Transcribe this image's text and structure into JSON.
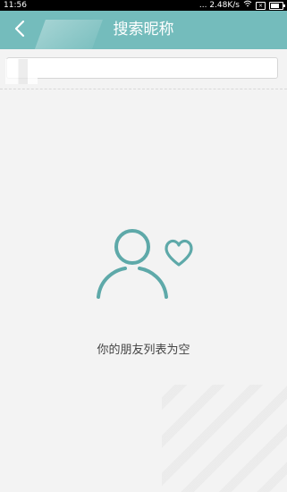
{
  "status_bar": {
    "time": "11:56",
    "net_speed": "... 2.48K/s",
    "icons": [
      "wifi-icon",
      "sim-x-icon",
      "battery-icon"
    ]
  },
  "header": {
    "title": "搜索昵称",
    "back_icon": "back-arrow-icon"
  },
  "search": {
    "value": "",
    "placeholder": ""
  },
  "empty_state": {
    "icon": "friend-empty-icon",
    "message": "你的朋友列表为空"
  },
  "colors": {
    "header_bg": "#74bcbc",
    "icon_teal": "#5ea9a9",
    "page_bg": "#f3f3f3"
  }
}
